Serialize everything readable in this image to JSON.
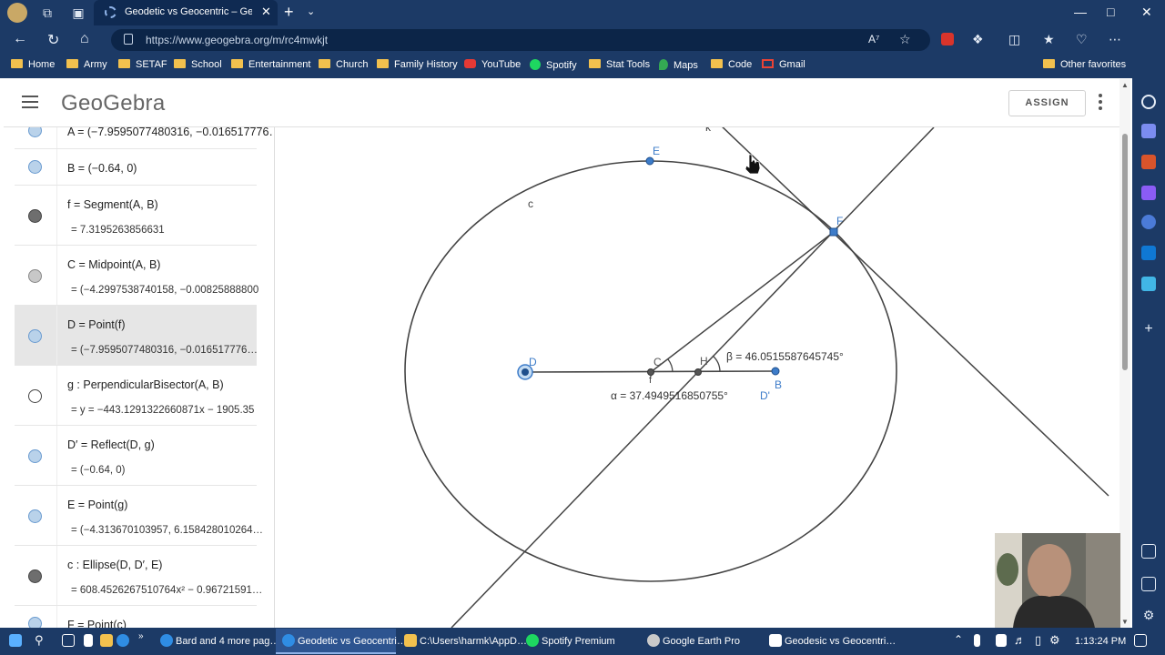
{
  "browser": {
    "tab_title": "Geodetic vs Geocentric – GeoGe",
    "url": "https://www.geogebra.org/m/rc4mwkjt",
    "bookmarks": [
      "Home",
      "Army",
      "SETAF",
      "School",
      "Entertainment",
      "Church",
      "Family History",
      "YouTube",
      "Spotify",
      "Stat Tools",
      "Maps",
      "Code",
      "Gmail"
    ],
    "other_favorites": "Other favorites"
  },
  "geogebra": {
    "logo": "GeoGebra",
    "assign_label": "ASSIGN",
    "algebra": [
      {
        "id": "A",
        "def": "A = (−7.9595077480316, −0.016517776…",
        "value": "",
        "dot": "#b9d2ea",
        "border": "#6a9bd0"
      },
      {
        "id": "B",
        "def": "B = (−0.64, 0)",
        "value": "",
        "dot": "#b9d2ea",
        "border": "#6a9bd0"
      },
      {
        "id": "f",
        "def": "f = Segment(A, B)",
        "value": "= 7.3195263856631",
        "dot": "#6e6e6e",
        "border": "#444"
      },
      {
        "id": "C",
        "def": "C = Midpoint(A, B)",
        "value": "= (−4.2997538740158, −0.00825888800",
        "dot": "#c8c8c8",
        "border": "#888"
      },
      {
        "id": "D",
        "def": "D = Point(f)",
        "value": "= (−7.9595077480316, −0.016517776…",
        "dot": "#b9d2ea",
        "border": "#6a9bd0",
        "selected": true
      },
      {
        "id": "g",
        "def": "g : PerpendicularBisector(A, B)",
        "value": "= y = −443.1291322660871x − 1905.35",
        "dot": "#ffffff",
        "border": "#444"
      },
      {
        "id": "D'",
        "def": "D′ = Reflect(D, g)",
        "value": "= (−0.64, 0)",
        "dot": "#b9d2ea",
        "border": "#6a9bd0"
      },
      {
        "id": "E",
        "def": "E = Point(g)",
        "value": "= (−4.313670103957, 6.158428010264…",
        "dot": "#b9d2ea",
        "border": "#6a9bd0"
      },
      {
        "id": "c",
        "def": "c : Ellipse(D, D′, E)",
        "value": "= 608.4526267510764x² − 0.96721591…",
        "dot": "#6e6e6e",
        "border": "#444"
      },
      {
        "id": "F",
        "def": "F = Point(c)",
        "value": "",
        "dot": "#b9d2ea",
        "border": "#6a9bd0"
      }
    ],
    "canvas_labels": {
      "k": "k",
      "E": "E",
      "c": "c",
      "F": "F",
      "D": "D",
      "C": "C",
      "f": "f",
      "H": "H",
      "B": "B",
      "Dp": "D'",
      "beta": "β = 46.0515587645745°",
      "alpha": "α = 37.4949516850755°"
    }
  },
  "taskbar": {
    "items": [
      "Bard and 4 more pag…",
      "Geodetic vs Geocentri…",
      "C:\\Users\\harmk\\AppD…",
      "Spotify Premium",
      "Google Earth Pro",
      "Geodesic vs Geocentri…"
    ],
    "time": "1:13:24 PM"
  },
  "colors": {
    "chrome": "#1c3a66",
    "point": "#3d7cc9",
    "line": "#444444"
  }
}
